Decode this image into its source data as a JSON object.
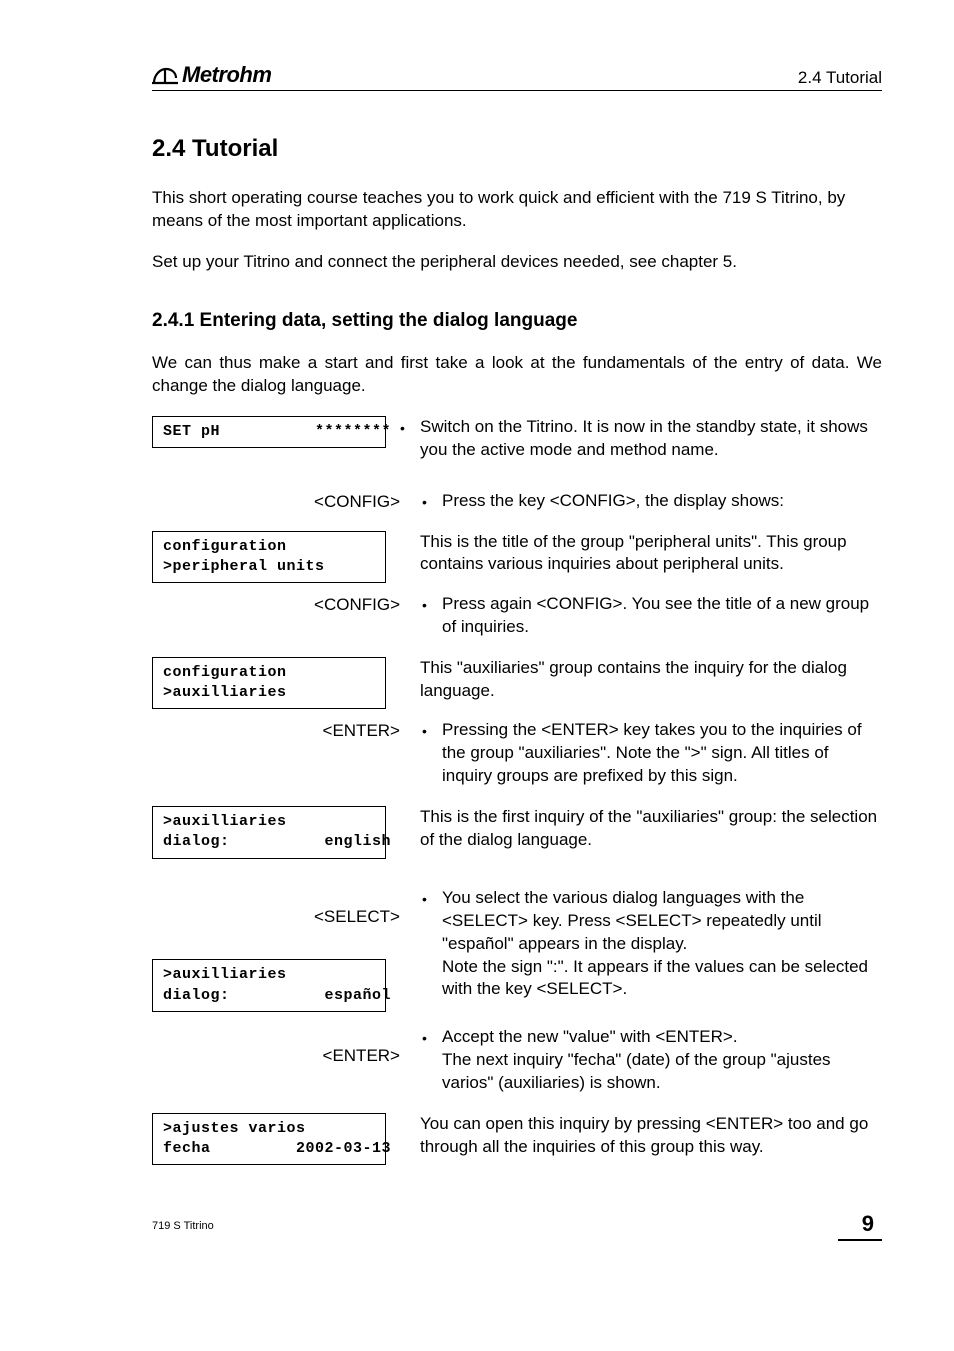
{
  "header": {
    "brand": "Metrohm",
    "section_ref": "2.4 Tutorial"
  },
  "title": "2.4  Tutorial",
  "intro1": "This short operating course teaches you to work quick and efficient with the 719 S Titrino, by means of the most important applications.",
  "intro2": "Set up your Titrino and connect the peripheral devices needed, see chapter 5.",
  "subtitle": "2.4.1  Entering data, setting the dialog language",
  "subintro": "We can thus make a start and first take a look at the fundamentals of the entry of data. We change the dialog language.",
  "rows": {
    "r1_lcd": "SET pH          ********",
    "r1_text": "Switch on the Titrino. It is now in the standby state, it shows you the active mode and method name.",
    "r2_key": "<CONFIG>",
    "r2_text": "Press the key <CONFIG>, the display shows:",
    "r3_lcd": "configuration\n>peripheral units",
    "r3_text": "This is the title of the group \"peripheral units\". This group contains various inquiries about peripheral units.",
    "r4_key": "<CONFIG>",
    "r4_text": "Press again <CONFIG>. You see the title of a new group of inquiries.",
    "r5_lcd": "configuration\n>auxilliaries",
    "r5_text": "This \"auxiliaries\" group contains the inquiry for the dialog language.",
    "r6_key": "<ENTER>",
    "r6_text": "Pressing the <ENTER> key takes you to the inquiries of the group \"auxiliaries\". Note the \">\" sign. All titles of inquiry groups are prefixed by this sign.",
    "r7_lcd": ">auxilliaries\ndialog:          english",
    "r7_text": "This is the first inquiry of the \"auxiliaries\" group: the selection of the dialog language.",
    "r8_key": "<SELECT>",
    "r8_text": "You select the various dialog languages with the <SELECT> key. Press <SELECT> repeatedly until \"español\" appears in the display.\nNote the sign \":\". It appears if the values can be selected with the key <SELECT>.",
    "r8_lcd": ">auxilliaries\ndialog:          español",
    "r9_key": "<ENTER>",
    "r9_text": "Accept the new \"value\" with <ENTER>.\nThe next inquiry \"fecha\" (date) of the group \"ajustes varios\" (auxiliaries) is shown.",
    "r10_lcd": ">ajustes varios\nfecha         2002-03-13",
    "r10_text": "You can open this inquiry by pressing <ENTER> too and go through all the inquiries of this group this way."
  },
  "footer": {
    "product": "719 S Titrino",
    "page": "9"
  }
}
